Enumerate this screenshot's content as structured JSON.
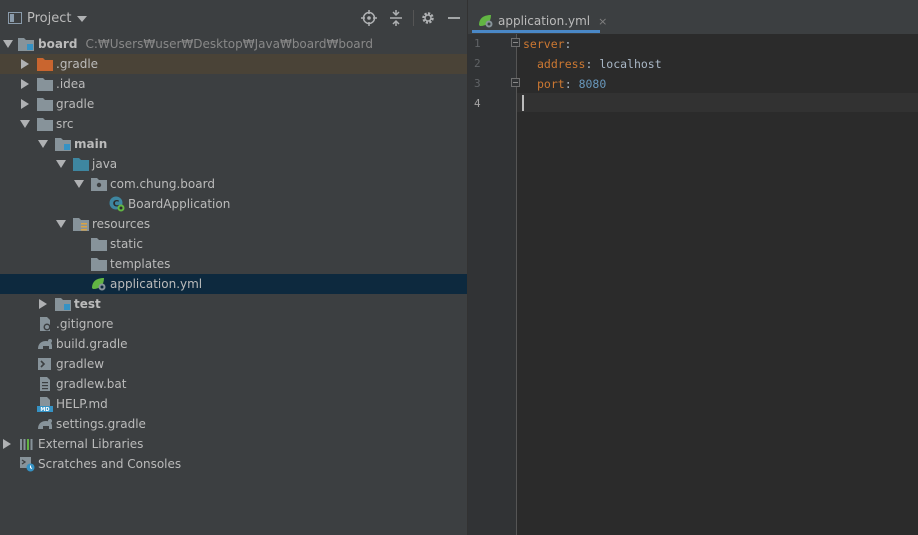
{
  "project_panel": {
    "title": "Project"
  },
  "tree": [
    {
      "label": "board",
      "path": "C:₩Users₩user₩Desktop₩Java₩board₩board",
      "icon": "module-folder-icon"
    },
    {
      "label": ".gradle",
      "icon": "excluded-folder-icon"
    },
    {
      "label": ".idea",
      "icon": "folder-icon"
    },
    {
      "label": "gradle",
      "icon": "folder-icon"
    },
    {
      "label": "src",
      "icon": "folder-icon"
    },
    {
      "label": "main",
      "icon": "module-folder-icon"
    },
    {
      "label": "java",
      "icon": "source-root-icon"
    },
    {
      "label": "com.chung.board",
      "icon": "package-icon"
    },
    {
      "label": "BoardApplication",
      "icon": "spring-boot-class-icon"
    },
    {
      "label": "resources",
      "icon": "resources-folder-icon"
    },
    {
      "label": "static",
      "icon": "folder-icon"
    },
    {
      "label": "templates",
      "icon": "folder-icon"
    },
    {
      "label": "application.yml",
      "icon": "spring-yml-icon"
    },
    {
      "label": "test",
      "icon": "module-folder-icon"
    },
    {
      "label": ".gitignore",
      "icon": "gitignore-file-icon"
    },
    {
      "label": "build.gradle",
      "icon": "gradle-file-icon"
    },
    {
      "label": "gradlew",
      "icon": "script-file-icon"
    },
    {
      "label": "gradlew.bat",
      "icon": "bat-file-icon"
    },
    {
      "label": "HELP.md",
      "icon": "markdown-file-icon"
    },
    {
      "label": "settings.gradle",
      "icon": "gradle-file-icon"
    },
    {
      "label": "External Libraries",
      "icon": "libraries-icon"
    },
    {
      "label": "Scratches and Consoles",
      "icon": "scratches-icon"
    }
  ],
  "editor": {
    "tab_label": "application.yml",
    "tab_close": "×",
    "line_numbers": [
      "1",
      "2",
      "3",
      "4"
    ],
    "code": {
      "line1_key": "server",
      "line1_colon": ":",
      "line2_key": "address",
      "line2_colon": ":",
      "line2_value": "localhost",
      "line3_key": "port",
      "line3_colon": ":",
      "line3_value": "8080"
    }
  },
  "colors": {
    "panel_bg": "#3c3f41",
    "editor_bg": "#2b2b2b",
    "selected_row": "#0d293e",
    "excluded_row": "#4a4337",
    "yaml_key": "#cc7832",
    "yaml_number": "#6897bb"
  }
}
